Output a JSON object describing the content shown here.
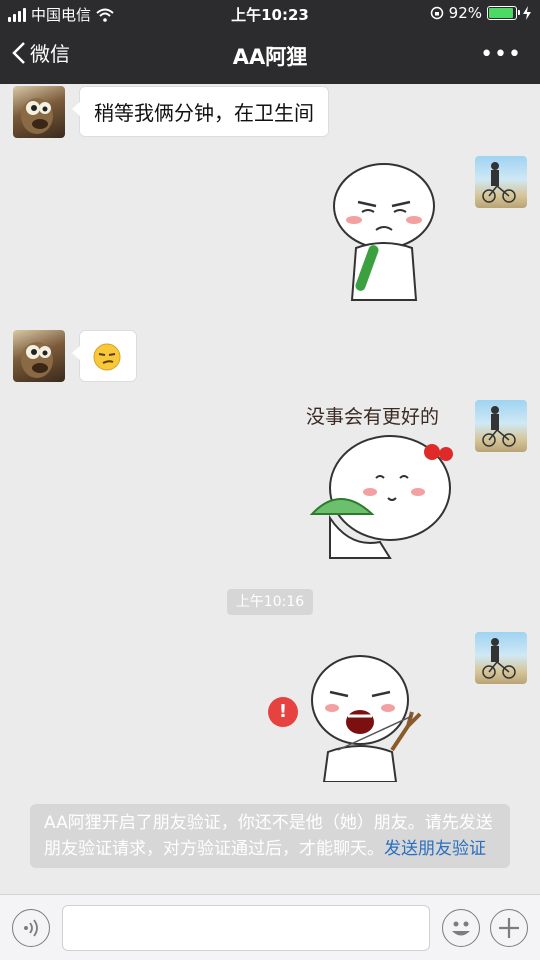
{
  "status_bar": {
    "carrier": "中国电信",
    "time": "上午10:23",
    "battery_pct": "92%",
    "battery_level": 0.92
  },
  "nav": {
    "back_label": "微信",
    "title": "AA阿狸",
    "more_label": "•••"
  },
  "chat": {
    "messages": [
      {
        "side": "left",
        "type": "text",
        "text": "稍等我俩分钟，在卫生间"
      },
      {
        "side": "right",
        "type": "sticker",
        "name": "sad-cucumber-sticker"
      },
      {
        "side": "left",
        "type": "emoji",
        "name": "smirk-emoji"
      },
      {
        "side": "right",
        "type": "sticker",
        "name": "turtle-shell-sticker",
        "caption": "没事会有更好的"
      },
      {
        "side": "right",
        "type": "sticker",
        "name": "slingshot-sticker",
        "failed": true
      }
    ],
    "time_separator": "上午10:16",
    "error_mark": "!",
    "system_notice": {
      "text": "AA阿狸开启了朋友验证，你还不是他（她）朋友。请先发送朋友验证请求，对方验证通过后，才能聊天。",
      "link": "发送朋友验证"
    }
  },
  "input_bar": {
    "input_value": ""
  },
  "colors": {
    "nav_bg": "#2c2c2e",
    "chat_bg": "#ebebeb",
    "error": "#e64340",
    "link": "#2a6fc0",
    "battery": "#4cd964"
  }
}
